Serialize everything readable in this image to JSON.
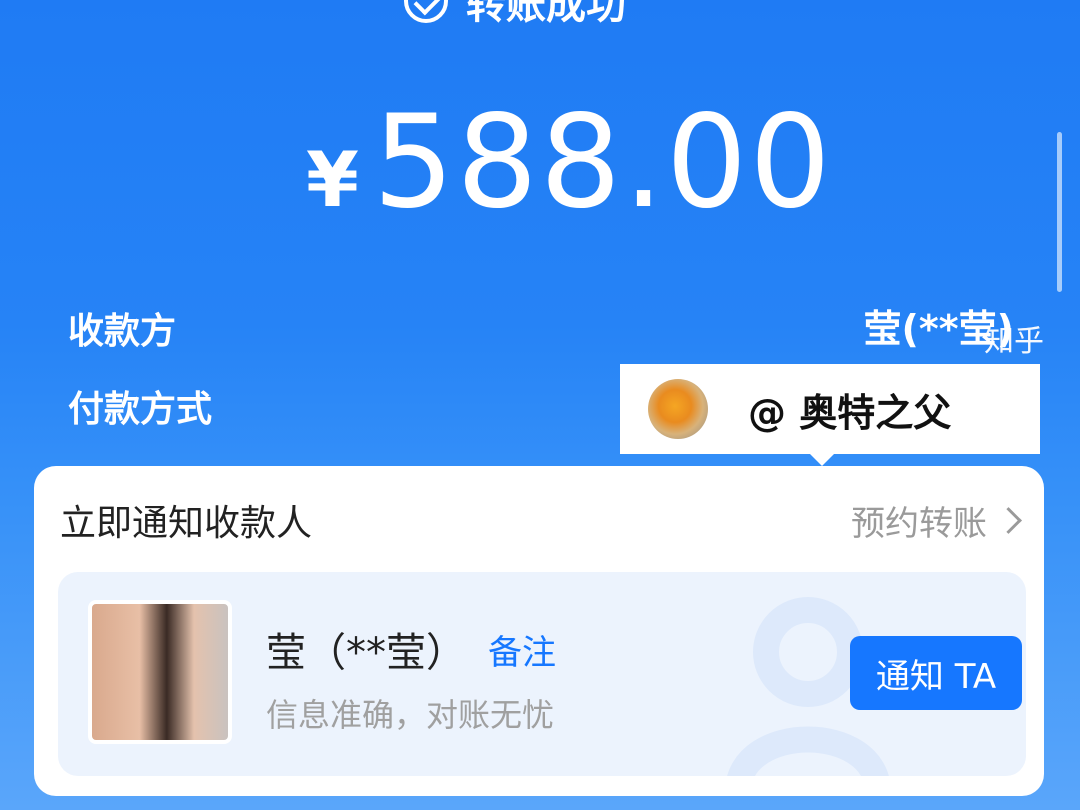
{
  "status": {
    "text": "转账成功"
  },
  "amount": {
    "currency": "¥",
    "value": "588.00"
  },
  "details": {
    "payee_label": "收款方",
    "payee_name": "莹(**莹)",
    "method_label": "付款方式"
  },
  "watermark": {
    "text": "知乎"
  },
  "tooltip": {
    "text": "@ 奥特之父"
  },
  "card": {
    "title": "立即通知收款人",
    "schedule_link": "预约转账",
    "contact": {
      "name": "莹（**莹）",
      "remark": "备注",
      "subtext": "信息准确，对账无忧"
    },
    "notify_button": "通知 TA"
  },
  "colors": {
    "accent": "#1677ff",
    "background_top": "#1f7bf4",
    "muted_text": "#9a9a9a"
  }
}
